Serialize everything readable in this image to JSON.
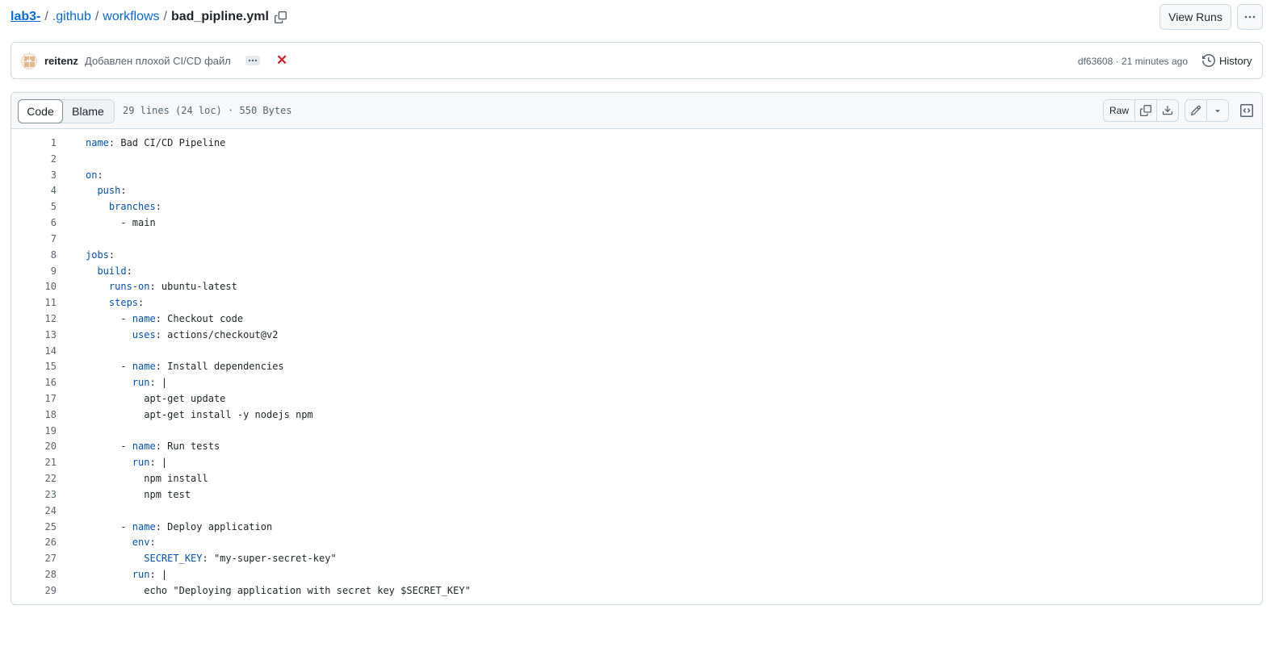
{
  "breadcrumb": {
    "repo": "lab3-",
    "sep": "/",
    "dir1": ".github",
    "dir2": "workflows",
    "file": "bad_pipline.yml"
  },
  "header": {
    "view_runs_label": "View Runs"
  },
  "commit": {
    "author": "reitenz",
    "message": "Добавлен плохой CI/CD файл",
    "status": "✕",
    "sha_time": "df63608 · 21 minutes ago",
    "history_label": "History"
  },
  "file": {
    "tabs": [
      "Code",
      "Blame"
    ],
    "meta": "29 lines (24 loc) · 550 Bytes",
    "raw_label": "Raw"
  },
  "colors": {
    "accent": "#0969da",
    "key": "#0550ae",
    "fail": "#d1242f",
    "border": "#d1d9e0"
  },
  "icons": [
    "copy-icon",
    "kebab-icon",
    "x-icon",
    "history-icon",
    "copy-icon",
    "download-icon",
    "pencil-icon",
    "triangle-down-icon",
    "code-square-icon"
  ],
  "code_lines": [
    {
      "key": "name",
      "text": ": Bad CI/CD Pipeline"
    },
    {
      "key": "",
      "text": ""
    },
    {
      "key": "on",
      "text": ":"
    },
    {
      "key": "  push",
      "text": ":"
    },
    {
      "key": "    branches",
      "text": ":"
    },
    {
      "key": "",
      "text": "      - main"
    },
    {
      "key": "",
      "text": ""
    },
    {
      "key": "jobs",
      "text": ":"
    },
    {
      "key": "  build",
      "text": ":"
    },
    {
      "key": "    runs-on",
      "text": ": ubuntu-latest"
    },
    {
      "key": "    steps",
      "text": ":"
    },
    {
      "pre": "      - ",
      "key": "name",
      "text": ": Checkout code"
    },
    {
      "key": "        uses",
      "text": ": actions/checkout@v2"
    },
    {
      "key": "",
      "text": ""
    },
    {
      "pre": "      - ",
      "key": "name",
      "text": ": Install dependencies"
    },
    {
      "key": "        run",
      "text": ": |"
    },
    {
      "key": "",
      "text": "          apt-get update"
    },
    {
      "key": "",
      "text": "          apt-get install -y nodejs npm"
    },
    {
      "key": "",
      "text": ""
    },
    {
      "pre": "      - ",
      "key": "name",
      "text": ": Run tests"
    },
    {
      "key": "        run",
      "text": ": |"
    },
    {
      "key": "",
      "text": "          npm install"
    },
    {
      "key": "",
      "text": "          npm test"
    },
    {
      "key": "",
      "text": ""
    },
    {
      "pre": "      - ",
      "key": "name",
      "text": ": Deploy application"
    },
    {
      "key": "        env",
      "text": ":"
    },
    {
      "key": "          SECRET_KEY",
      "text": ": \"my-super-secret-key\""
    },
    {
      "key": "        run",
      "text": ": |"
    },
    {
      "key": "",
      "text": "          echo \"Deploying application with secret key $SECRET_KEY\""
    }
  ]
}
